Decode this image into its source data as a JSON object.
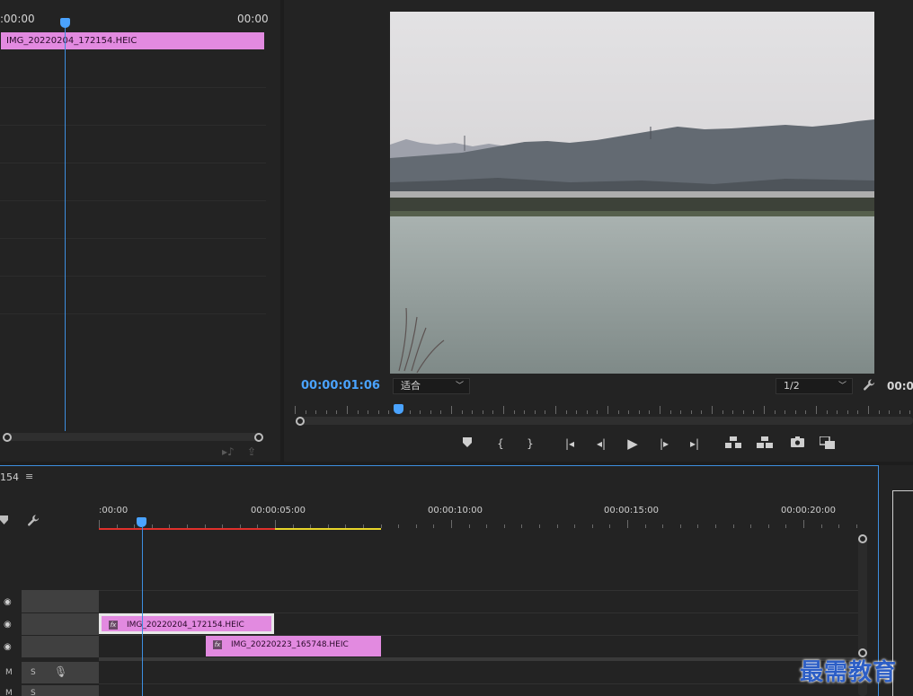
{
  "source_panel": {
    "time_left": ":00:00",
    "time_right": "00:00",
    "clip_name": "IMG_20220204_172154.HEIC"
  },
  "program_monitor": {
    "timecode": "00:00:01:06",
    "fit_select": "适合",
    "resolution_select": "1/2",
    "time_right": "00:0",
    "transport": {
      "add_marker": "add-marker",
      "mark_in": "{",
      "mark_out": "}",
      "go_to_in": "go-to-in",
      "step_back": "step-back",
      "play": "play",
      "step_forward": "step-forward",
      "go_to_out": "go-to-out",
      "lift": "lift",
      "extract": "extract",
      "export_frame": "camera",
      "compare": "compare"
    }
  },
  "timeline": {
    "sequence_name": "154",
    "menu": "≡",
    "ruler_labels": [
      ":00:00",
      "00:00:05:00",
      "00:00:10:00",
      "00:00:15:00",
      "00:00:20:00"
    ],
    "clips": [
      {
        "name": "IMG_20220204_172154.HEIC",
        "fx": "fx"
      },
      {
        "name": "IMG_20220223_165748.HEIC",
        "fx": "fx"
      }
    ],
    "audio_track": {
      "mute": "M",
      "solo": "S"
    }
  },
  "watermark": "最需教育",
  "colors": {
    "accent": "#4aa3ff",
    "clip": "#e28ae0",
    "work_area_red": "#e0302b",
    "work_area_yellow": "#e8d62a"
  }
}
